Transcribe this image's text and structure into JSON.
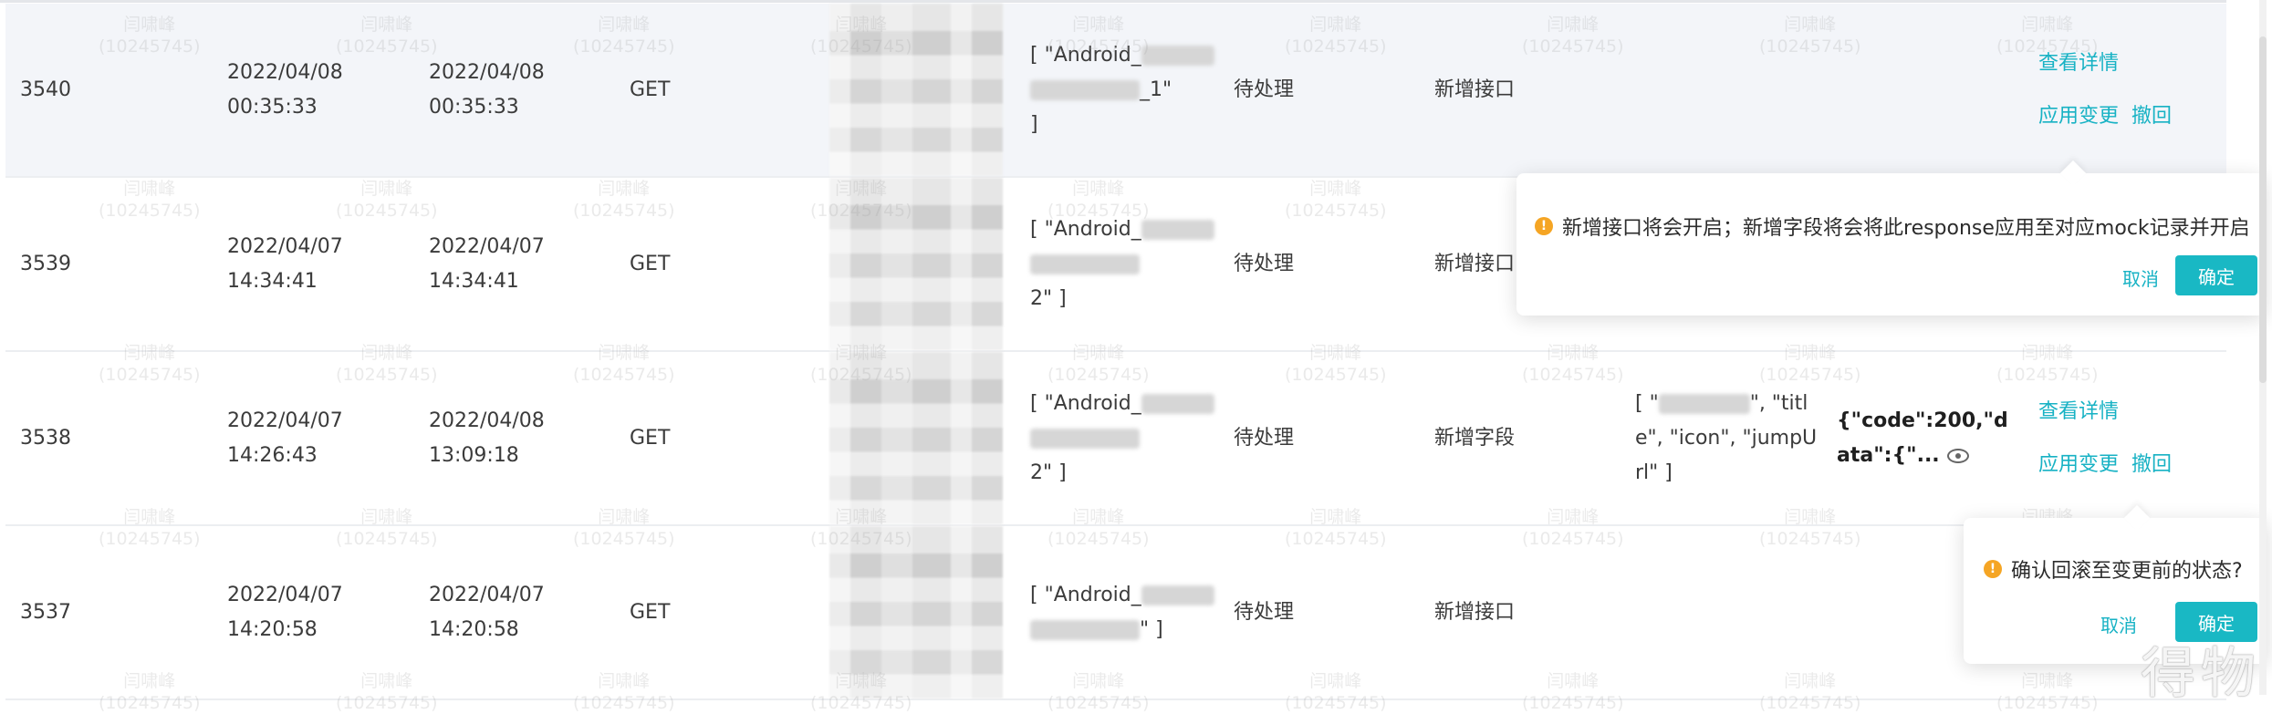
{
  "rows": [
    {
      "id": "3540",
      "created": "2022/04/08 00:35:33",
      "updated": "2022/04/08 00:35:33",
      "method": "GET",
      "args_prefix": "[ \"Android_",
      "args_mid": "_1\"",
      "args_suffix": "]",
      "status": "待处理",
      "change_type": "新增接口",
      "fields_pre": "",
      "fields_post": "",
      "response": "",
      "ops_detail": "查看详情",
      "ops_apply": "应用变更",
      "ops_revoke": "撤回"
    },
    {
      "id": "3539",
      "created": "2022/04/07 14:34:41",
      "updated": "2022/04/07 14:34:41",
      "method": "GET",
      "args_prefix": "[ \"Android_",
      "args_mid": "",
      "args_suffix": "2\" ]",
      "status": "待处理",
      "change_type": "新增接口",
      "fields_pre": "",
      "fields_post": "",
      "response": "",
      "ops_detail": "",
      "ops_apply": "",
      "ops_revoke": ""
    },
    {
      "id": "3538",
      "created": "2022/04/07 14:26:43",
      "updated": "2022/04/08 13:09:18",
      "method": "GET",
      "args_prefix": "[ \"Android_",
      "args_mid": "",
      "args_suffix": "2\" ]",
      "status": "待处理",
      "change_type": "新增字段",
      "fields_pre": "[ \"",
      "fields_post": "\", \"title\", \"icon\", \"jumpUrl\" ]",
      "response": "{\"code\":200,\"data\":{\"...",
      "ops_detail": "查看详情",
      "ops_apply": "应用变更",
      "ops_revoke": "撤回"
    },
    {
      "id": "3537",
      "created": "2022/04/07 14:20:58",
      "updated": "2022/04/07 14:20:58",
      "method": "GET",
      "args_prefix": "[ \"Android_",
      "args_mid": "",
      "args_suffix": "\" ]",
      "status": "待处理",
      "change_type": "新增接口",
      "fields_pre": "",
      "fields_post": "",
      "response": "",
      "ops_detail": "",
      "ops_apply": "",
      "ops_revoke": ""
    }
  ],
  "popover_apply": {
    "message": "新增接口将会开启；新增字段将会将此response应用至对应mock记录并开启",
    "cancel": "取消",
    "confirm": "确定"
  },
  "popover_revoke": {
    "message": "确认回滚至变更前的状态?",
    "cancel": "取消",
    "confirm": "确定"
  },
  "watermark": {
    "name": "闫啸峰",
    "id": "(10245745)"
  },
  "brand_watermark": "得物",
  "colors": {
    "accent": "#17b2c4",
    "primary_button": "#19b8c4",
    "warning": "#f5a524",
    "row_highlight": "#f3f5f9"
  }
}
